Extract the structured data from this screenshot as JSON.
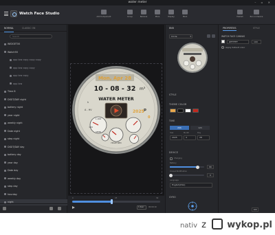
{
  "window": {
    "title": "water meter"
  },
  "app": {
    "name": "Watch Face Studio"
  },
  "toolbar": {
    "buttons": [
      {
        "id": "add-component",
        "label": "Add Component"
      },
      {
        "id": "group",
        "label": "Group"
      },
      {
        "id": "remove",
        "label": "Remove"
      },
      {
        "id": "more",
        "label": "More"
      },
      {
        "id": "display",
        "label": "Display"
      },
      {
        "id": "mark",
        "label": "Mark"
      },
      {
        "id": "publish",
        "label": "Publish"
      },
      {
        "id": "run-on-device",
        "label": "Run on Device"
      }
    ]
  },
  "left_panel": {
    "tabs": [
      "NORMAL",
      "CLASSIC ON"
    ],
    "search_placeholder": "Search",
    "layers": [
      {
        "label": "WIDGET00",
        "sub": false
      },
      {
        "label": "Watch90",
        "sub": false
      },
      {
        "label": "app low copy copy copy",
        "sub": true
      },
      {
        "label": "app low copy copy",
        "sub": true
      },
      {
        "label": "app low copy",
        "sub": true
      },
      {
        "label": "app low",
        "sub": true
      },
      {
        "label": "Time 8",
        "sub": false
      },
      {
        "label": "DIGIT/DAY night",
        "sub": false
      },
      {
        "label": "battery night",
        "sub": false
      },
      {
        "label": "year night",
        "sub": false
      },
      {
        "label": "weekly night",
        "sub": false
      },
      {
        "label": "Date night",
        "sub": false
      },
      {
        "label": "step night",
        "sub": false
      },
      {
        "label": "DIGIT/DAY day",
        "sub": false
      },
      {
        "label": "battery day",
        "sub": false
      },
      {
        "label": "year day",
        "sub": false
      },
      {
        "label": "Date day",
        "sub": false
      },
      {
        "label": "weekly day",
        "sub": false
      },
      {
        "label": "step day",
        "sub": false
      },
      {
        "label": "hourday",
        "sub": false
      },
      {
        "label": "night",
        "sub": false
      }
    ]
  },
  "watch": {
    "date_line": "Mon, Apr 28",
    "time_line": "10 - 08 - 32",
    "unit": "m³",
    "brand": "WATER METER",
    "year": "2025",
    "small_left": "A - HV",
    "small_p": "p",
    "small_h": "h",
    "small_label_left": "STEPS",
    "small_label_bottom": "HEART BPM",
    "dial_top": "1,000",
    "dial_left": "100",
    "dial_right": "0"
  },
  "timeline": {
    "start_label": "0",
    "mid_label": "23",
    "end_label": "30",
    "progress": 0.45,
    "speed_value": "1.0sec",
    "time_label": "00:00:10"
  },
  "middle_panel": {
    "title": "BNB",
    "dropdown_value": "Circle",
    "section_style": "STYLE",
    "section_theme": "THEME COLOR",
    "swatches": [
      "#e8a84c",
      "#111111",
      "#ffffff",
      "#c0281e"
    ],
    "section_time": "TIME",
    "time_segments": [
      "24h",
      "12h"
    ],
    "time_field_labels": [
      "Year",
      "Month",
      "Day"
    ],
    "time_field_values": [
      "2025",
      "4",
      "28"
    ],
    "section_device": "DEVICE",
    "charging_label": "Charging",
    "battery_label": "Battery",
    "battery_value": "80",
    "battery_fraction": 0.8,
    "unread_label": "Unread Notification",
    "unread_value": "0",
    "language_label": "Language",
    "language_value": "English(USA)",
    "section_gyro": "GYRO"
  },
  "right_panel": {
    "tabs": [
      "PROPERTIES",
      "STYLE"
    ],
    "heading": "WATCH FACE CANVAS",
    "color_value": "#FFFFFF",
    "opacity_value": "100",
    "checkbox_label": "Apply default color",
    "zoom_value": "100"
  },
  "footer_watermark": {
    "name": "nativ",
    "sep": "z",
    "site": "wykop.pl"
  }
}
